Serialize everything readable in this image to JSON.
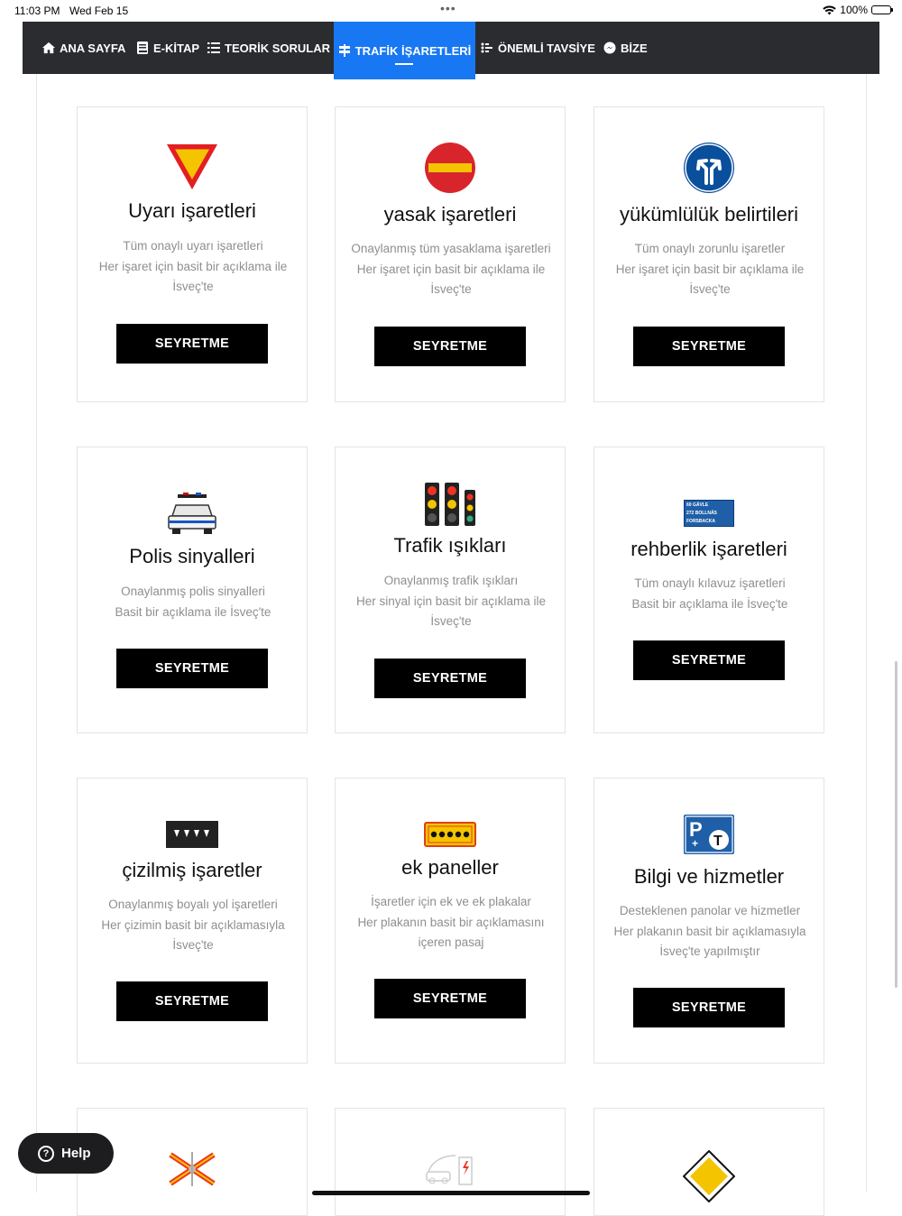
{
  "status_bar": {
    "time": "11:03 PM",
    "date": "Wed Feb 15",
    "battery": "100%"
  },
  "nav": {
    "items": [
      {
        "label": "ANA SAYFA",
        "icon": "home-icon"
      },
      {
        "label": "E-KİTAP",
        "icon": "book-icon"
      },
      {
        "label": "TEORİK SORULAR",
        "icon": "list-icon"
      },
      {
        "label": "TRAFİK İŞARETLERİ",
        "icon": "signpost-icon",
        "active": true
      },
      {
        "label": "ÖNEMLİ TAVSİYE",
        "icon": "tips-icon"
      },
      {
        "label": "BİZE",
        "icon": "messenger-icon"
      }
    ],
    "active_color": "#1877f2"
  },
  "cards": [
    {
      "title": "Uyarı işaretleri",
      "lines": [
        "Tüm onaylı uyarı işaretleri",
        "Her işaret için basit bir açıklama ile",
        "İsveç'te"
      ],
      "button": "SEYRETME",
      "icon": "yield-sign-icon"
    },
    {
      "title": "yasak işaretleri",
      "lines": [
        "Onaylanmış tüm yasaklama işaretleri",
        "Her işaret için basit bir açıklama ile",
        "İsveç'te"
      ],
      "button": "SEYRETME",
      "icon": "no-entry-sign-icon"
    },
    {
      "title": "yükümlülük belirtileri",
      "lines": [
        "Tüm onaylı zorunlu işaretler",
        "Her işaret için basit bir açıklama ile",
        "İsveç'te"
      ],
      "button": "SEYRETME",
      "icon": "mandatory-direction-sign-icon"
    },
    {
      "title": "Polis sinyalleri",
      "lines": [
        "Onaylanmış polis sinyalleri",
        "Basit bir açıklama ile İsveç'te"
      ],
      "button": "SEYRETME",
      "icon": "police-car-icon"
    },
    {
      "title": "Trafik ışıkları",
      "lines": [
        "Onaylanmış trafik ışıkları",
        "Her sinyal için basit bir açıklama ile",
        "İsveç'te"
      ],
      "button": "SEYRETME",
      "icon": "traffic-lights-icon"
    },
    {
      "title": "rehberlik işaretleri",
      "lines": [
        "Tüm onaylı kılavuz işaretleri",
        "Basit bir açıklama ile İsveç'te"
      ],
      "button": "SEYRETME",
      "icon": "guide-sign-icon",
      "guide_lines": [
        "60 GÄVLE",
        "272 BOLLNÄS",
        "FORSBACKA"
      ]
    },
    {
      "title": "çizilmiş işaretler",
      "lines": [
        "Onaylanmış boyalı yol işaretleri",
        "Her çizimin basit bir açıklamasıyla",
        "İsveç'te"
      ],
      "button": "SEYRETME",
      "icon": "road-marking-icon"
    },
    {
      "title": "ek paneller",
      "lines": [
        "İşaretler için ek ve ek plakalar",
        "Her plakanın basit bir açıklamasını",
        "içeren pasaj"
      ],
      "button": "SEYRETME",
      "icon": "additional-panel-icon"
    },
    {
      "title": "Bilgi ve hizmetler",
      "lines": [
        "Desteklenen panolar ve hizmetler",
        "Her plakanın basit bir açıklamasıyla",
        "İsveç'te yapılmıştır"
      ],
      "button": "SEYRETME",
      "icon": "parking-info-sign-icon"
    }
  ],
  "partial_icons": [
    "railway-crossing-icon",
    "ev-charging-icon",
    "priority-road-icon"
  ],
  "help": {
    "label": "Help"
  }
}
